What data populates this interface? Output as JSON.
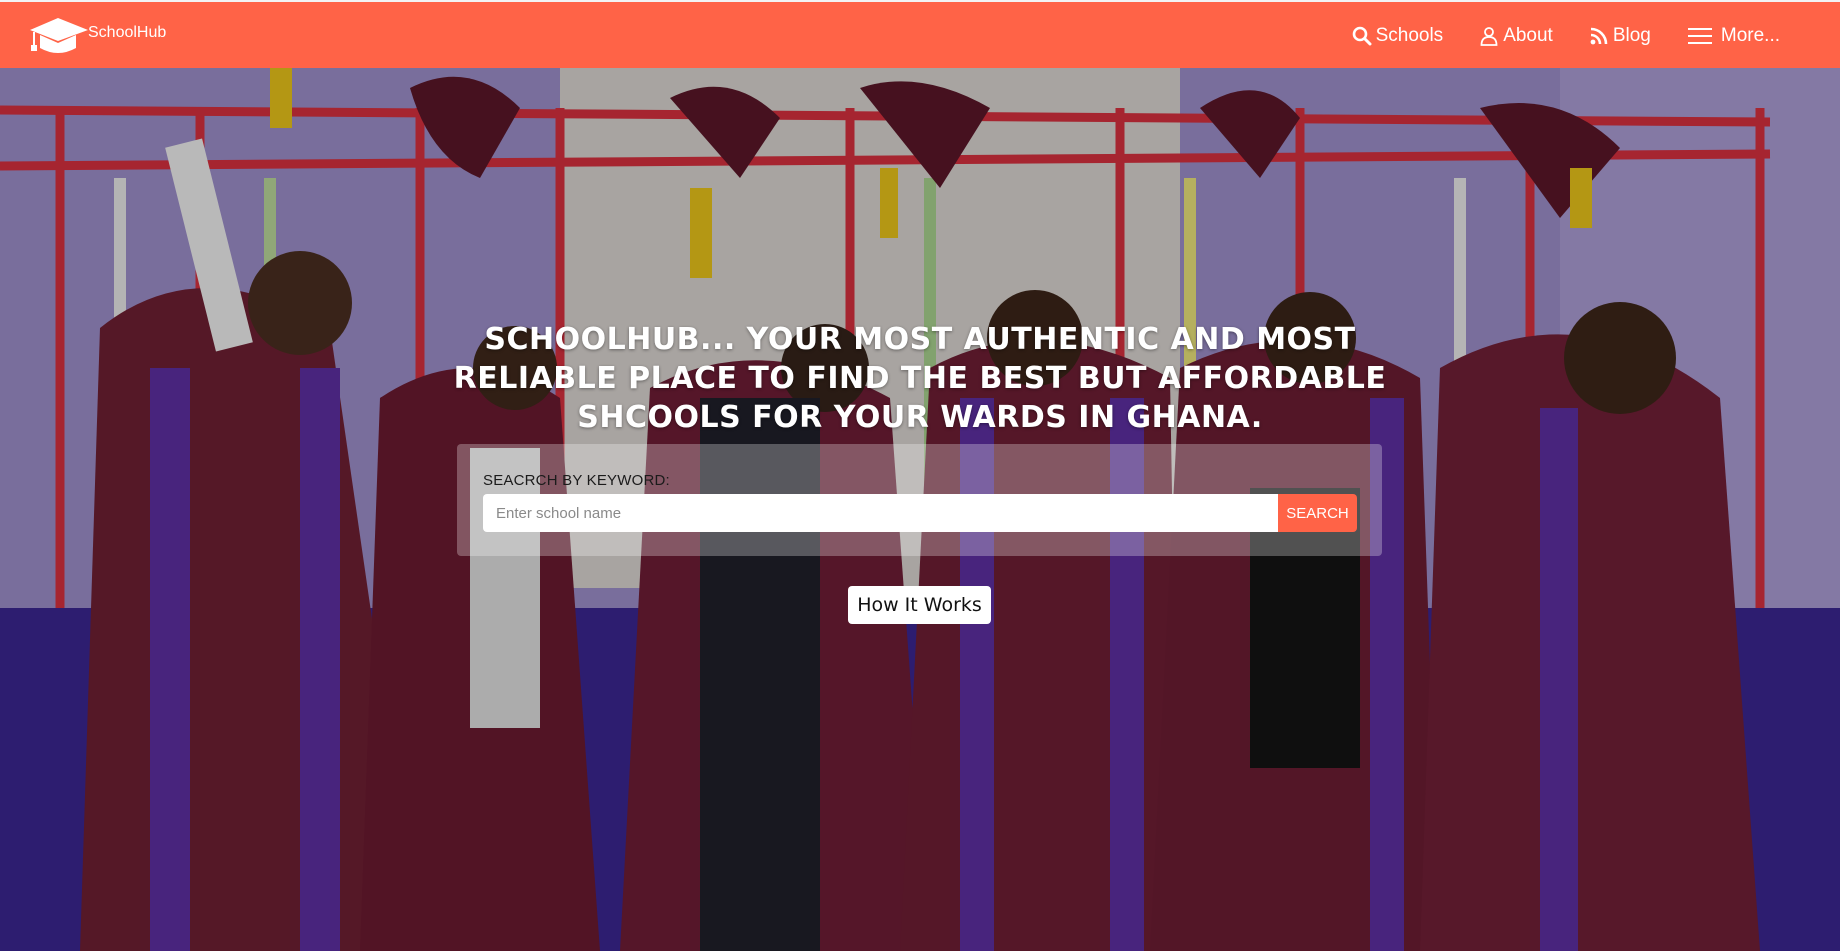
{
  "navbar": {
    "brand": "SchoolHub",
    "brand_icon": "graduation-cap-icon",
    "links": [
      {
        "label": "Schools",
        "icon": "search-icon"
      },
      {
        "label": "About",
        "icon": "user-icon"
      },
      {
        "label": "Blog",
        "icon": "rss-icon"
      },
      {
        "label": "More...",
        "icon": "hamburger-menu-icon"
      }
    ],
    "color": "#ff6347"
  },
  "hero": {
    "headline": "SCHOOLHUB... YOUR MOST AUTHENTIC AND MOST RELIABLE PLACE TO FIND THE BEST BUT AFFORDABLE SHCOOLS FOR YOUR WARDS IN GHANA.",
    "search": {
      "label": "SEACRCH BY KEYWORD:",
      "placeholder": "Enter school name",
      "value": "",
      "button": "SEARCH"
    },
    "how_it_works": "How It Works"
  }
}
